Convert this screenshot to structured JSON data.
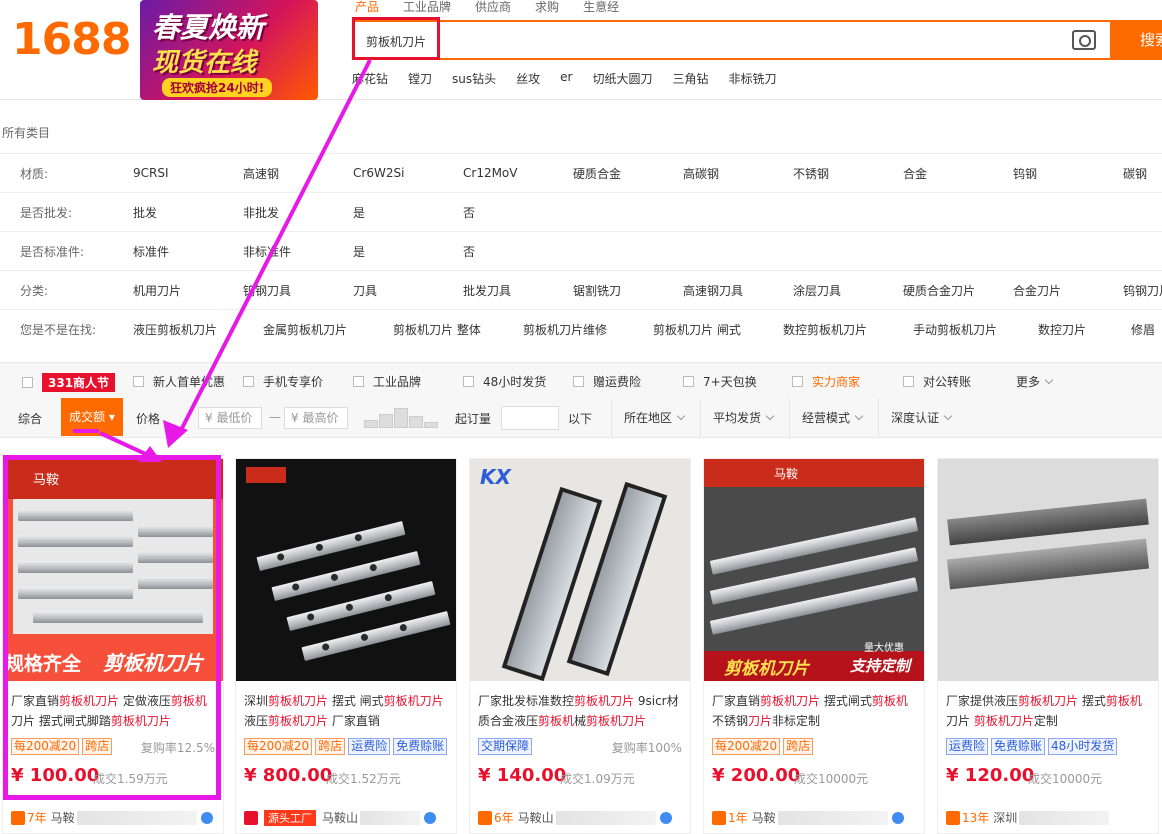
{
  "header": {
    "logo": "1688",
    "promo": {
      "line1": "春夏焕新",
      "line2": "现货在线",
      "line3": "狂欢疯抢24小时!"
    },
    "search_tabs": [
      "产品",
      "工业品牌",
      "供应商",
      "求购",
      "生意经"
    ],
    "search_value": "剪板机刀片",
    "search_button": "搜索",
    "hot_words": [
      "麻花钻",
      "镗刀",
      "sus钻头",
      "丝攻",
      "er",
      "切纸大圆刀",
      "三角钻",
      "非标铣刀"
    ]
  },
  "category": {
    "all_label": "所有类目",
    "rows": [
      {
        "label": "材质:",
        "options": [
          "9CRSI",
          "高速钢",
          "Cr6W2Si",
          "Cr12MoV",
          "硬质合金",
          "高碳钢",
          "不锈钢",
          "合金",
          "钨钢",
          "碳钢"
        ]
      },
      {
        "label": "是否批发:",
        "options": [
          "批发",
          "非批发",
          "是",
          "否"
        ]
      },
      {
        "label": "是否标准件:",
        "options": [
          "标准件",
          "非标准件",
          "是",
          "否"
        ]
      },
      {
        "label": "分类:",
        "options": [
          "机用刀片",
          "钨钢刀具",
          "刀具",
          "批发刀具",
          "锯割铣刀",
          "高速钢刀具",
          "涂层刀具",
          "硬质合金刀片",
          "合金刀片",
          "钨钢刀片"
        ]
      },
      {
        "label": "您是不是在找:",
        "options": [
          "液压剪板机刀片",
          "金属剪板机刀片",
          "剪板机刀片 整体",
          "剪板机刀片维修",
          "剪板机刀片 闸式",
          "数控剪板机刀片",
          "手动剪板机刀片",
          "数控刀片",
          "修眉"
        ]
      }
    ]
  },
  "filters": {
    "items": [
      "新人首单优惠",
      "手机专享价",
      "工业品牌",
      "48小时发货",
      "赠运费险",
      "7+天包换",
      "实力商家",
      "对公转账"
    ],
    "promo_tag": "331商人节",
    "more": "更多"
  },
  "sort": {
    "general": "综合",
    "active": "成交额",
    "price": "价格",
    "min_price": "¥ 最低价",
    "dash": "—",
    "max_price": "¥ 最高价",
    "moq": "起订量",
    "below": "以下",
    "dropdowns": [
      "所在地区",
      "平均发货",
      "经营模式",
      "深度认证"
    ]
  },
  "products": [
    {
      "title_parts": [
        "厂家直销",
        "剪板机刀片",
        " 定做液压",
        "剪板机",
        "刀片 摆式闸式脚踏",
        "剪板机刀片",
        ""
      ],
      "tags": [
        {
          "t": "每200减20",
          "c": "o"
        },
        {
          "t": "跨店",
          "c": "o"
        }
      ],
      "rate": "复购率12.5%",
      "price": "¥ 100.00",
      "sold": "成交1.59万元",
      "years": "7年",
      "seller": "马鞍",
      "image_text": {
        "top": "马鞍",
        "left": "规格齐全",
        "right": "剪板机刀片"
      }
    },
    {
      "title_parts": [
        "深圳",
        "剪板机刀片",
        " 摆式 闸式",
        "剪板机刀片",
        " 液压",
        "剪板机刀片",
        " 厂家直销"
      ],
      "tags": [
        {
          "t": "每200减20",
          "c": "o"
        },
        {
          "t": "跨店",
          "c": "o"
        },
        {
          "t": "运费险",
          "c": "b"
        },
        {
          "t": "免费赊账",
          "c": "b"
        }
      ],
      "rate": "",
      "price": "¥ 800.00",
      "sold": "成交1.52万元",
      "years": "源头工厂",
      "seller": "马鞍山",
      "image_text": {}
    },
    {
      "title_parts": [
        "厂家批发标准数控",
        "剪板机刀片",
        " 9sicr材质合金液压",
        "剪板机",
        "械",
        "剪板机刀片",
        ""
      ],
      "tags": [
        {
          "t": "交期保障",
          "c": "b"
        }
      ],
      "rate": "复购率100%",
      "price": "¥ 140.00",
      "sold": "成交1.09万元",
      "years": "6年",
      "seller": "马鞍山",
      "image_text": {
        "top": "KX"
      }
    },
    {
      "title_parts": [
        "厂家直销",
        "剪板机刀片",
        " 摆式闸式",
        "剪板机",
        " 不锈钢",
        "刀片",
        "非标定制"
      ],
      "tags": [
        {
          "t": "每200减20",
          "c": "o"
        },
        {
          "t": "跨店",
          "c": "o"
        }
      ],
      "rate": "",
      "price": "¥ 200.00",
      "sold": "成交10000元",
      "years": "1年",
      "seller": "马鞍",
      "image_text": {
        "top": "马鞍",
        "left": "剪板机刀片",
        "right": "支持定制",
        "badge": "量大优惠"
      }
    },
    {
      "title_parts": [
        "厂家提供液压",
        "剪板机刀片",
        " 摆式",
        "剪板机",
        " 刀片 ",
        "剪板机刀片",
        "定制"
      ],
      "tags": [
        {
          "t": "运费险",
          "c": "b"
        },
        {
          "t": "免费赊账",
          "c": "b"
        },
        {
          "t": "48小时发货",
          "c": "b"
        }
      ],
      "rate": "",
      "price": "¥ 120.00",
      "sold": "成交10000元",
      "years": "13年",
      "seller": "深圳",
      "image_text": {}
    }
  ],
  "colors": {
    "brand": "#ff6a00",
    "highlight": "#e619e6",
    "price": "#e8112d",
    "annotation_box": "#e8112d"
  },
  "icons": [
    "camera-icon",
    "shop-icon",
    "verified-icon"
  ]
}
